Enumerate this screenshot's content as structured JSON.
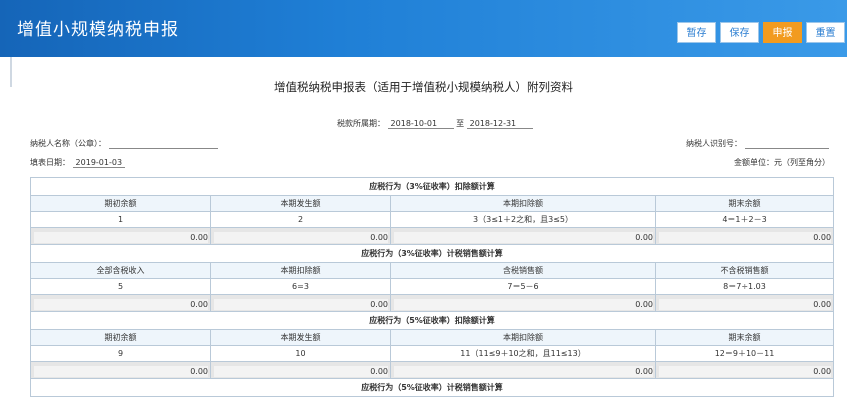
{
  "header": {
    "title": "增值小规模纳税申报",
    "buttons": {
      "temp_save": "暂存",
      "save": "保存",
      "submit": "申报",
      "reset": "重置"
    }
  },
  "doc": {
    "title": "增值税纳税申报表（适用于增值税小规模纳税人）附列资料",
    "period_label": "税款所属期：",
    "period_start": "2018-10-01",
    "period_to": "至",
    "period_end": "2018-12-31",
    "taxpayer_name_label": "纳税人名称（公章）：",
    "taxpayer_name_value": "",
    "taxpayer_id_label": "纳税人识别号：",
    "fill_date_label": "填表日期：",
    "fill_date_value": "2019-01-03",
    "amount_unit": "金额单位：元（列至角分）"
  },
  "sections": [
    {
      "title": "应税行为（3%征收率）扣除额计算",
      "columns": [
        "期初余额",
        "本期发生额",
        "本期扣除额",
        "期末余额"
      ],
      "formulas": [
        "1",
        "2",
        "3（3≤1＋2之和，且3≤5）",
        "4＝1＋2－3"
      ],
      "values": [
        "0.00",
        "0.00",
        "0.00",
        "0.00"
      ]
    },
    {
      "title": "应税行为（3%征收率）计税销售额计算",
      "columns": [
        "全部含税收入",
        "本期扣除额",
        "含税销售额",
        "不含税销售额"
      ],
      "formulas": [
        "5",
        "6=3",
        "7＝5－6",
        "8＝7÷1.03"
      ],
      "values": [
        "0.00",
        "0.00",
        "0.00",
        "0.00"
      ]
    },
    {
      "title": "应税行为（5%征收率）扣除额计算",
      "columns": [
        "期初余额",
        "本期发生额",
        "本期扣除额",
        "期末余额"
      ],
      "formulas": [
        "9",
        "10",
        "11（11≤9＋10之和，且11≤13）",
        "12＝9＋10－11"
      ],
      "values": [
        "0.00",
        "0.00",
        "0.00",
        "0.00"
      ]
    },
    {
      "title": "应税行为（5%征收率）计税销售额计算"
    }
  ]
}
